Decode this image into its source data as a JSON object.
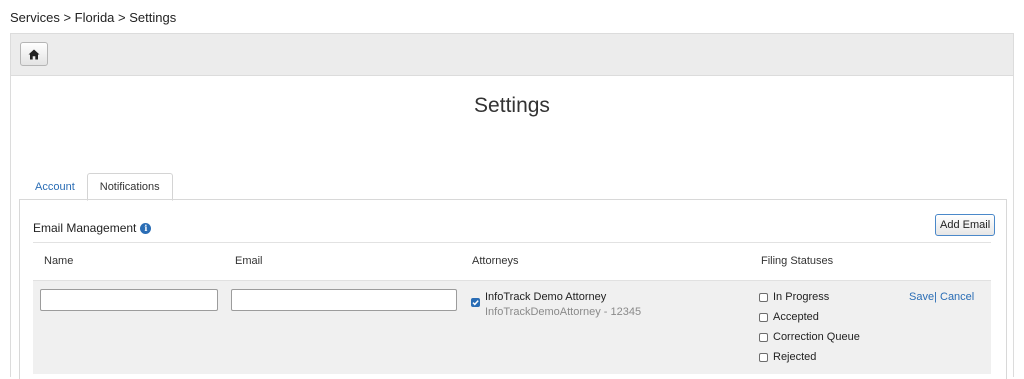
{
  "breadcrumb": "Services > Florida > Settings",
  "header": {
    "home_icon": "home-icon"
  },
  "page_title": "Settings",
  "tabs": [
    {
      "label": "Account",
      "active": false
    },
    {
      "label": "Notifications",
      "active": true
    }
  ],
  "email_management": {
    "title": "Email Management",
    "info_icon": "info-icon",
    "add_button": "Add Email",
    "columns": {
      "name": "Name",
      "email": "Email",
      "attorneys": "Attorneys",
      "filing_statuses": "Filing Statuses"
    },
    "edit_row": {
      "name_value": "",
      "email_value": "",
      "attorney": {
        "checked": true,
        "name": "InfoTrack Demo Attorney",
        "detail": "InfoTrackDemoAttorney - 12345"
      },
      "statuses": [
        {
          "label": "In Progress",
          "checked": false
        },
        {
          "label": "Accepted",
          "checked": false
        },
        {
          "label": "Correction Queue",
          "checked": false
        },
        {
          "label": "Rejected",
          "checked": false
        }
      ],
      "save_label": "Save",
      "separator": "|",
      "cancel_label": "Cancel"
    }
  },
  "colors": {
    "link": "#2a6db5",
    "header_bg": "#ececec",
    "row_bg": "#f0f0f0"
  }
}
